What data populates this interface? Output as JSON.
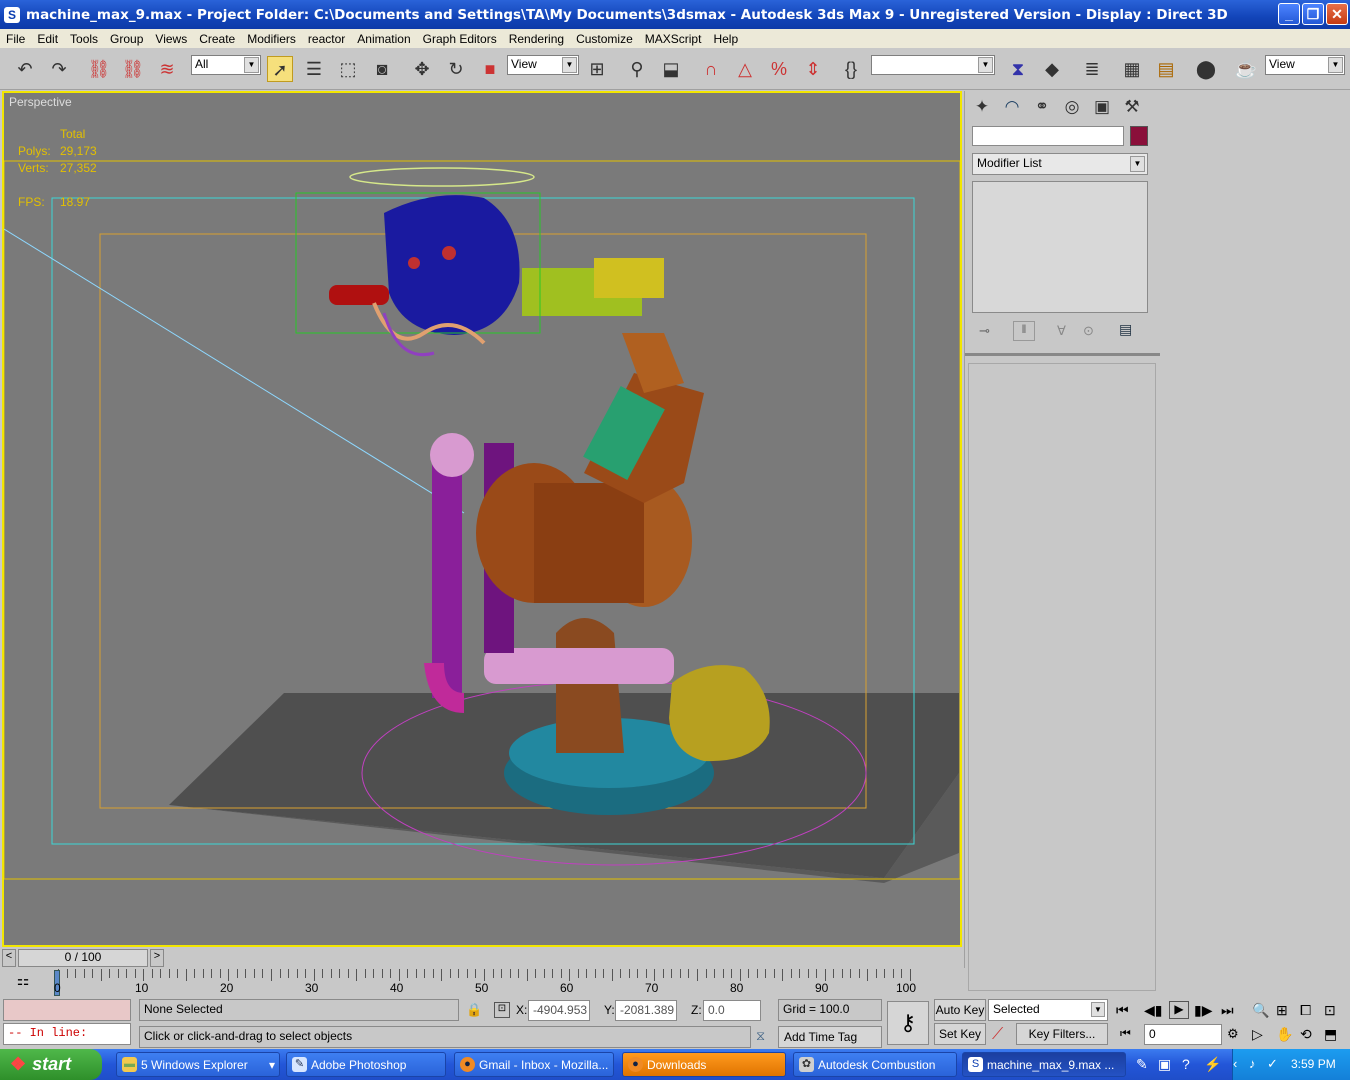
{
  "window": {
    "title": "machine_max_9.max     - Project Folder: C:\\Documents and Settings\\TA\\My Documents\\3dsmax     - Autodesk 3ds Max 9   - Unregistered Version      - Display : Direct 3D",
    "minimize_glyph": "_",
    "restore_glyph": "❐",
    "close_glyph": "✕"
  },
  "menu": [
    "File",
    "Edit",
    "Tools",
    "Group",
    "Views",
    "Create",
    "Modifiers",
    "reactor",
    "Animation",
    "Graph Editors",
    "Rendering",
    "Customize",
    "MAXScript",
    "Help"
  ],
  "toolbar": {
    "selection_filter": "All",
    "ref_coord": "View",
    "named_selection": "",
    "view_dropdown": "View"
  },
  "viewport": {
    "label": "Perspective",
    "stats_header": "Total",
    "polys_label": "Polys:",
    "polys_value": "29,173",
    "verts_label": "Verts:",
    "verts_value": "27,352",
    "fps_label": "FPS:",
    "fps_value": "18.97"
  },
  "command_panel": {
    "object_name": "",
    "modifier_list": "Modifier List"
  },
  "timeline": {
    "frame_display": "0 / 100",
    "current_frame": 0,
    "total_frames": 100,
    "ticks": [
      "0",
      "10",
      "20",
      "30",
      "40",
      "50",
      "60",
      "70",
      "80",
      "90",
      "100"
    ]
  },
  "status": {
    "in_line": "-- In line:",
    "selection": "None Selected",
    "prompt": "Click or click-and-drag to select objects",
    "x_label": "X:",
    "x_value": "-4904.953",
    "y_label": "Y:",
    "y_value": "-2081.389",
    "z_label": "Z:",
    "z_value": "0.0",
    "grid": "Grid = 100.0",
    "add_time_tag": "Add Time Tag",
    "auto_key": "Auto Key",
    "set_key": "Set Key",
    "key_mode": "Selected",
    "key_filters": "Key Filters...",
    "frame_field": "0"
  },
  "taskbar": {
    "start": "start",
    "items": [
      {
        "label": "5 Windows Explorer",
        "icon": "folder-icon",
        "color": "#f3c94e"
      },
      {
        "label": "Adobe Photoshop",
        "icon": "photoshop-icon",
        "color": "#d7e6ff"
      },
      {
        "label": "Gmail - Inbox - Mozilla...",
        "icon": "firefox-icon",
        "color": "#f08a24"
      },
      {
        "label": "Downloads",
        "icon": "firefox-icon",
        "color": "#f08a24"
      },
      {
        "label": "Autodesk Combustion",
        "icon": "combustion-icon",
        "color": "#cfcfcf"
      },
      {
        "label": "machine_max_9.max ...",
        "icon": "3dsmax-icon",
        "color": "#ffffff"
      }
    ],
    "clock": "3:59 PM"
  }
}
